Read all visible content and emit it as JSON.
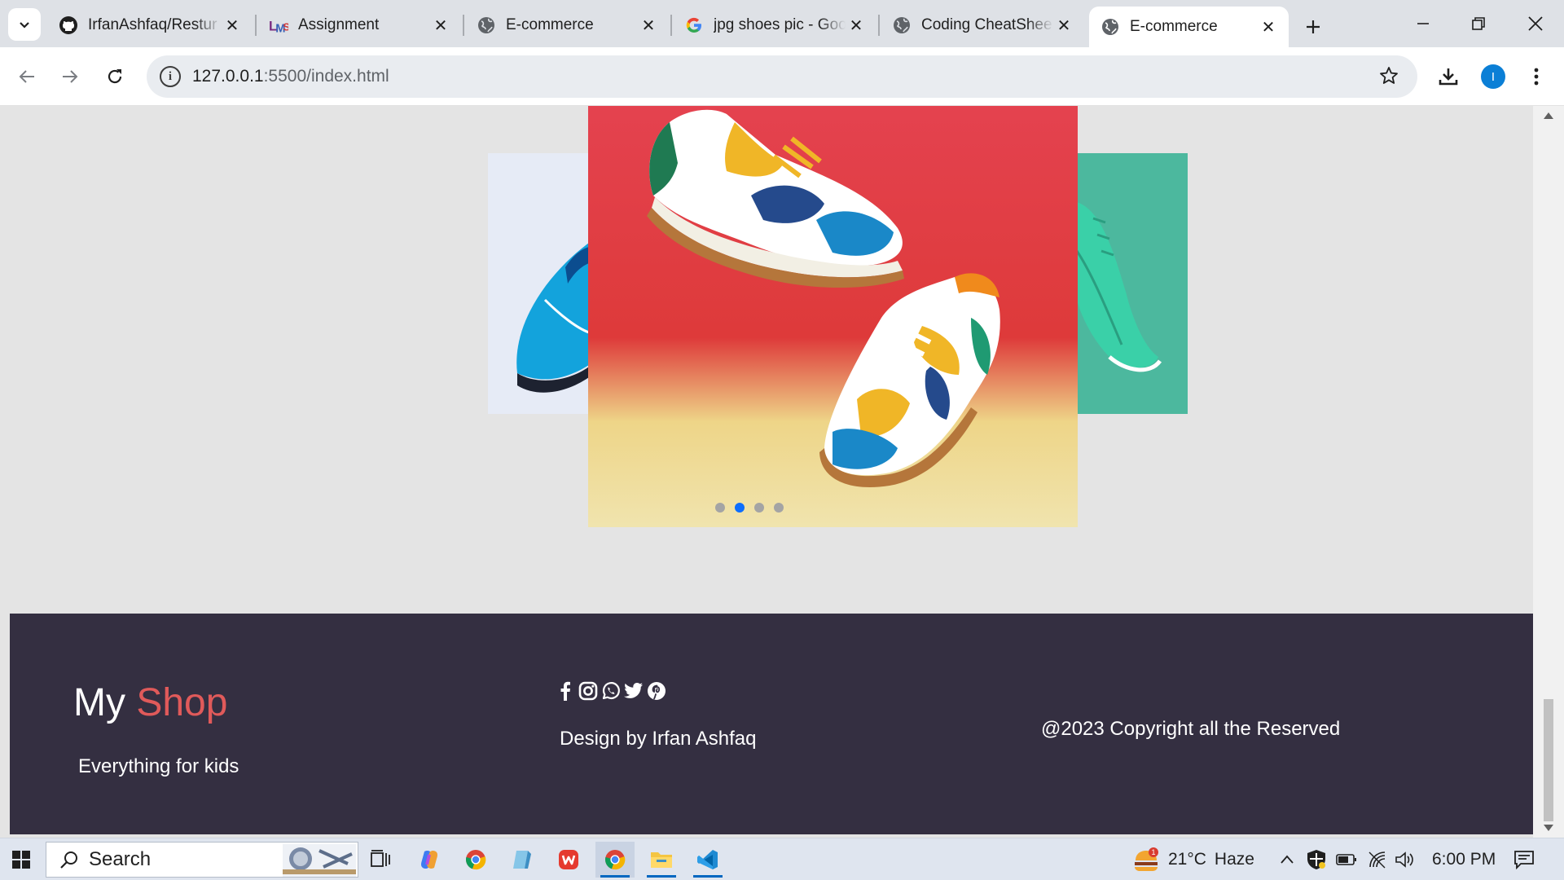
{
  "browser": {
    "tabs": [
      {
        "title": "IrfanAshfaq/Restur",
        "favicon": "github-icon"
      },
      {
        "title": "Assignment",
        "favicon": "lms-icon"
      },
      {
        "title": "E-commerce",
        "favicon": "globe-icon"
      },
      {
        "title": "jpg shoes pic - Goo",
        "favicon": "google-icon"
      },
      {
        "title": "Coding CheatShee",
        "favicon": "globe-icon"
      },
      {
        "title": "E-commerce",
        "favicon": "globe-icon",
        "active": true
      }
    ],
    "url_host": "127.0.0.1",
    "url_rest": ":5500/index.html",
    "profile_initial": "I"
  },
  "page": {
    "slider": {
      "slides": [
        "shoe-blue",
        "shoe-colorful",
        "shoe-green"
      ],
      "dot_count": 4,
      "active_dot": 2
    },
    "footer": {
      "brand_first": "My",
      "brand_second": "Shop",
      "tagline": "Everything for kids",
      "social_icons": [
        "facebook-icon",
        "instagram-icon",
        "whatsapp-icon",
        "twitter-icon",
        "pinterest-icon"
      ],
      "designer": "Design by Irfan Ashfaq",
      "copyright": "@2023 Copyright all the Reserved"
    },
    "colors": {
      "footer_bg": "#342f41",
      "brand_accent": "#e05a5a",
      "dot_active": "#0d6efd"
    }
  },
  "taskbar": {
    "search_label": "Search",
    "weather_temp": "21°C",
    "weather_text": "Haze",
    "weather_badge": "1",
    "time": "6:00 PM"
  }
}
